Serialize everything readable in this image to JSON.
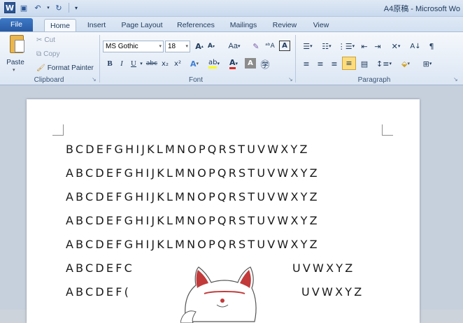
{
  "title": "A4原稿 - Microsoft Wo",
  "tabs": [
    "File",
    "Home",
    "Insert",
    "Page Layout",
    "References",
    "Mailings",
    "Review",
    "View"
  ],
  "clipboard": {
    "paste": "Paste",
    "cut": "Cut",
    "copy": "Copy",
    "format_painter": "Format Painter",
    "label": "Clipboard"
  },
  "font": {
    "name": "MS Gothic",
    "size": "18",
    "change_case": "Aa",
    "label": "Font"
  },
  "paragraph": {
    "label": "Paragraph"
  },
  "document": {
    "lines": [
      "BCDEFGHIJKLMNOPQRSTUVWXYZ",
      "ABCDEFGHIJKLMNOPQRSTUVWXYZ",
      "ABCDEFGHIJKLMNOPQRSTUVWXYZ",
      "ABCDEFGHIJKLMNOPQRSTUVWXYZ",
      "ABCDEFGHIJKLMNOPQRSTUVWXYZ",
      "ABCDEFC",
      "UVWXYZ",
      "ABCDEF(",
      "UVWXYZ"
    ]
  }
}
